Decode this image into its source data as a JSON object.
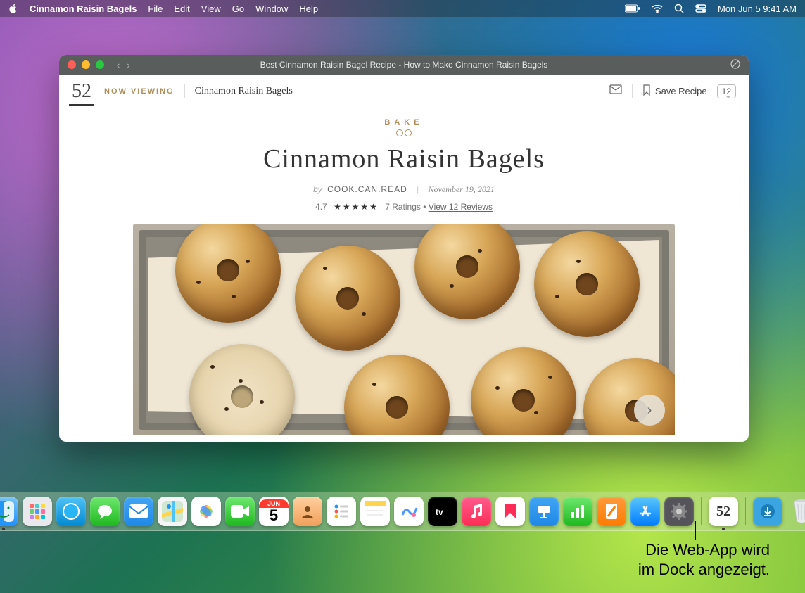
{
  "menubar": {
    "app_name": "Cinnamon Raisin Bagels",
    "items": [
      "File",
      "Edit",
      "View",
      "Go",
      "Window",
      "Help"
    ],
    "clock": "Mon Jun 5  9:41 AM"
  },
  "window": {
    "title": "Best Cinnamon Raisin Bagel Recipe - How to Make Cinnamon Raisin Bagels",
    "logo": "52",
    "now_viewing": "NOW VIEWING",
    "breadcrumb": "Cinnamon Raisin Bagels",
    "save_recipe": "Save Recipe",
    "comment_count": "12"
  },
  "recipe": {
    "category": "BAKE",
    "title": "Cinnamon Raisin Bagels",
    "by_label": "by",
    "author": "COOK.CAN.READ",
    "date": "November 19, 2021",
    "rating_value": "4.7",
    "stars": "★★★★★",
    "ratings_label": "7 Ratings",
    "reviews_link": "View 12 Reviews"
  },
  "dock": {
    "calendar": {
      "month": "JUN",
      "day": "5"
    },
    "webapp_label": "52"
  },
  "callout": {
    "line1": "Die Web-App wird",
    "line2": "im Dock angezeigt."
  }
}
